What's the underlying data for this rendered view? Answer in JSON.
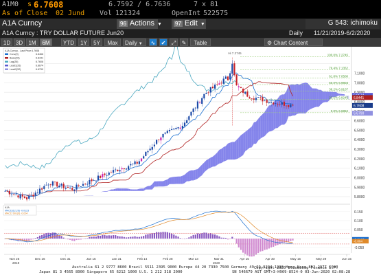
{
  "quote": {
    "symbol": "A1M0",
    "prefix": "s",
    "last": "6.7608",
    "bid_ask": "6.7592 / 6.7636",
    "size": "7 x 81",
    "asof_label": "As of Close",
    "asof_date": "02 Jund",
    "vol_label": "Vol",
    "vol": "121324",
    "oi_label": "OpenInt",
    "oi": "522575"
  },
  "ticker_bar": {
    "ticker": "A1A Curncy",
    "actions": {
      "num": "96",
      "label": "Actions"
    },
    "edit": {
      "num": "97",
      "label": "Edit"
    },
    "function": "G 543: ichimoku"
  },
  "title_bar": {
    "security": "A1A Curncy : TRY DOLLAR FUTURE Jun20",
    "period": "Daily",
    "range": "11/21/2019-6/2/2020"
  },
  "toolbar": {
    "periods": [
      "1D",
      "3D",
      "1M",
      "6M",
      "YTD",
      "1Y",
      "5Y",
      "Max"
    ],
    "active_period": "6M",
    "frequency": "Daily",
    "table": "Table",
    "chart_content": "Chart Content"
  },
  "legend": {
    "title": "A1A Curncy - Last Price 6.7608",
    "items": [
      {
        "label": "Conv(9)",
        "value": "6.8466",
        "color": "#1a6fd0"
      },
      {
        "label": "Base(26)",
        "value": "6.8441",
        "color": "#b02020"
      },
      {
        "label": "Lag(26)",
        "value": "6.7608",
        "color": "#4aa8c0"
      },
      {
        "label": "Lead1(26)",
        "value": "6.8674",
        "color": "#5a5ad0"
      },
      {
        "label": "Lead2(52)",
        "value": "6.6790",
        "color": "#9090e0"
      }
    ]
  },
  "price_axis": {
    "labels": [
      "7.1000",
      "7.0000",
      "6.9000",
      "6.8000",
      "6.7000",
      "6.6000",
      "6.5000",
      "6.4000",
      "6.3000",
      "6.2000",
      "6.1000",
      "6.0000",
      "5.9000",
      "5.8000"
    ],
    "tags": [
      {
        "label": "6.8674",
        "value": 6.8674,
        "color": "#5a5ad0"
      },
      {
        "label": "6.8466",
        "value": 6.8466,
        "color": "#1a6fd0"
      },
      {
        "label": "6.8441",
        "value": 6.8441,
        "color": "#b02020"
      },
      {
        "label": "6.7608",
        "value": 6.7608,
        "color": "#1a3c8a"
      },
      {
        "label": "6.6790",
        "value": 6.679,
        "color": "#9090e0"
      }
    ]
  },
  "fib_labels": [
    "100.0% 7.2745",
    "76.4% 7.1352",
    "61.8% 7.0500",
    "50.0% 6.9803",
    "38.2% 6.9107",
    "23.6% 6.8245",
    "0.0% 6.6852"
  ],
  "peak_label": "Hi 7.2745",
  "macd": {
    "legend_title": "A1A",
    "line1": "MACD(12,26) -0.0123",
    "line2": "MACD SIG(9) -0.004",
    "axis_labels": [
      "0.150",
      "0.100",
      "0.050",
      "0.000",
      "-0.050"
    ],
    "tags": [
      {
        "label": "-0.0123",
        "color": "#1a6fd0"
      },
      {
        "label": "-0.004",
        "color": "#e08a2a"
      }
    ]
  },
  "x_axis": {
    "months": [
      "Nov 25",
      "Dec 16",
      "Dec 31",
      "Jan 15",
      "Jan 31",
      "Feb 14",
      "Feb 28",
      "Mar 13",
      "Mar 31",
      "Apr 15",
      "Apr 30",
      "May 15",
      "May 29",
      "Jun 15"
    ],
    "years": [
      "2019",
      "2020"
    ]
  },
  "footer": {
    "line1": "Australia 61 2 9777 8600 Brazil 5511 2395 9000 Europe 44 20 7330 7500 Germany 49 69 9204 1210 Hong Kong 852 2977 6000",
    "line2": "Japan 81 3 4565 8900          Singapore 65 6212 1000          U.S. 1 212 318 2000",
    "line3": "Copyright 2020 Bloomberg Finance L.P.",
    "line4": "SN 546679 AST GMT+3-H969-8524-0 03-Jun-2020 02:08:28"
  },
  "chart_data": {
    "type": "candlestick",
    "x": [
      "2019-11-25",
      "2019-12-16",
      "2019-12-31",
      "2020-01-15",
      "2020-01-31",
      "2020-02-14",
      "2020-02-28",
      "2020-03-13",
      "2020-03-31",
      "2020-04-15",
      "2020-04-30",
      "2020-05-15",
      "2020-05-29",
      "2020-06-02"
    ],
    "close_approx": [
      5.86,
      5.78,
      5.95,
      5.88,
      5.98,
      6.08,
      6.16,
      6.43,
      6.55,
      6.88,
      7.05,
      6.86,
      6.8,
      6.76
    ],
    "ylim": [
      5.75,
      7.35
    ],
    "last": 6.7608,
    "macd_ylim": [
      -0.08,
      0.18
    ]
  }
}
